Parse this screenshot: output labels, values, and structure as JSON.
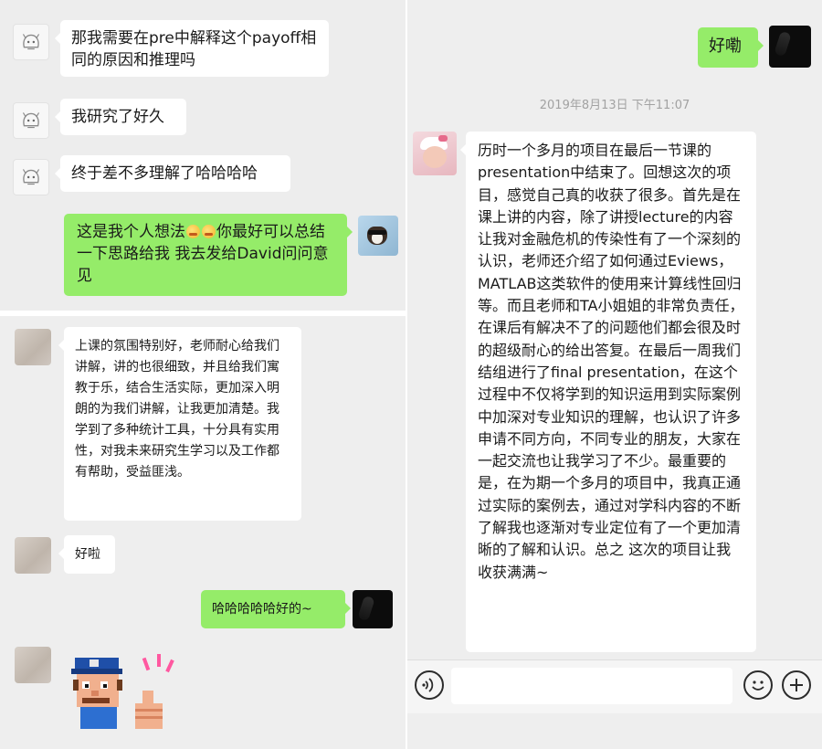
{
  "left_top_chat": {
    "messages": [
      {
        "text": "那我需要在pre中解释这个payoff相同的原因和推理吗"
      },
      {
        "text": "我研究了好久"
      },
      {
        "text": "终于差不多理解了哈哈哈哈"
      },
      {
        "text_a": "这是我个人想法",
        "text_b": "你最好可以总结一下思路给我 我去发给David问问意见"
      }
    ]
  },
  "left_bottom_chat": {
    "messages": [
      {
        "text": "上课的氛围特别好，老师耐心给我们讲解，讲的也很细致，并且给我们寓教于乐，结合生活实际，更加深入明朗的为我们讲解，让我更加清楚。我学到了多种统计工具，十分具有实用性，对我未来研究生学习以及工作都有帮助，受益匪浅。"
      },
      {
        "text": "好啦"
      },
      {
        "text": "哈哈哈哈哈好的~"
      }
    ],
    "sticker": "pixel-character-thumbs-up"
  },
  "right_chat": {
    "messages": [
      {
        "text": "好嘞"
      }
    ],
    "timestamp": "2019年8月13日 下午11:07",
    "long_message": "历时一个多月的项目在最后一节课的presentation中结束了。回想这次的项目，感觉自己真的收获了很多。首先是在课上讲的内容，除了讲授lecture的内容让我对金融危机的传染性有了一个深刻的认识，老师还介绍了如何通过Eviews，MATLAB这类软件的使用来计算线性回归等。而且老师和TA小姐姐的非常负责任， 在课后有解决不了的问题他们都会很及时的超级耐心的给出答复。在最后一周我们结组进行了final presentation，在这个过程中不仅将学到的知识运用到实际案例中加深对专业知识的理解，也认识了许多申请不同方向，不同专业的朋友，大家在一起交流也让我学习了不少。最重要的是，在为期一个多月的项目中，我真正通过实际的案例去，通过对学科内容的不断了解我也逐渐对专业定位有了一个更加清晰的了解和认识。总之 这次的项目让我收获满满~",
    "input_bar": {
      "voice_icon": "voice-icon",
      "emoji_icon": "emoji-icon",
      "plus_icon": "plus-icon"
    }
  },
  "colors": {
    "chat_background": "#ededed",
    "received_bubble": "#ffffff",
    "sent_bubble": "#95ec69",
    "timestamp_text": "#a2a2a2"
  }
}
